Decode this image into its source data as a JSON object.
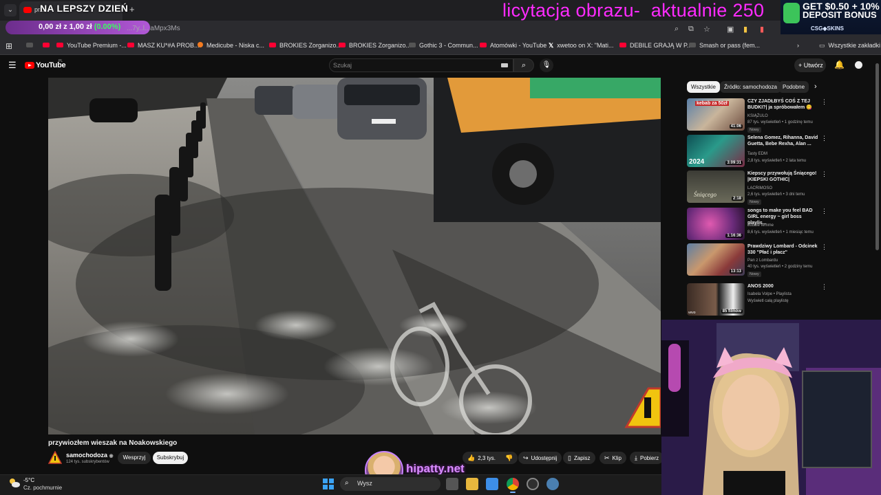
{
  "browser": {
    "tab_title": "pr... ",
    "tab_overlay_title": "NA LEPSZY DZIEŃ",
    "new_tab": "+",
    "url": "...7y..l...aMpx3Ms",
    "bookmarks": [
      {
        "label": "YouTube Premium -...",
        "icon": "youtube-icon"
      },
      {
        "label": "MASZ KU*#A PROB...",
        "icon": "youtube-icon"
      },
      {
        "label": "Medicube - Niska c...",
        "icon": "medicube-icon"
      },
      {
        "label": "BROKIES Zorganizo...",
        "icon": "youtube-icon"
      },
      {
        "label": "BROKIES Zorganizo...",
        "icon": "youtube-icon"
      },
      {
        "label": "Gothic 3 - Commun...",
        "icon": "globe-icon"
      },
      {
        "label": "Atomówki - YouTube",
        "icon": "youtube-icon"
      },
      {
        "label": "xwetoo on X: \"Mati...",
        "icon": "x-icon"
      },
      {
        "label": "DEBILE GRAJĄ W P...",
        "icon": "youtube-icon"
      },
      {
        "label": "Smash or pass (fem...",
        "icon": "globe-icon"
      }
    ],
    "all_bookmarks": "Wszystkie zakładki"
  },
  "stream_overlay": {
    "price_text": "0,00 zł z 1,00 zł",
    "price_pct": "(0.00%)",
    "auction_text": "licytacja obrazu-  aktualnie 250",
    "promo_line1": "GET $0.50 + 10%",
    "promo_line2": "DEPOSIT BONUS",
    "promo_brand": "CSG◆SKINS",
    "hipatty": "hipatty.net"
  },
  "youtube": {
    "logo_text": "YouTube",
    "country": "PL",
    "search_placeholder": "Szukaj",
    "create_label": "Utwórz",
    "video_title": "przywiozłem wieszak na Noakowskiego",
    "channel_name": "samochodoza",
    "channel_subs": "124 tys. subskrybentów",
    "support_label": "Wesprzyj",
    "subscribe_label": "Subskrybuj",
    "likes": "2,3 tys.",
    "share_label": "Udostępnij",
    "save_label": "Zapisz",
    "clip_label": "Klip",
    "download_label": "Pobierz",
    "chips": [
      "Wszystkie",
      "Źródło: samochodoza",
      "Podobne"
    ],
    "recommendations": [
      {
        "title": "CZY ZJADŁBYŚ COŚ Z TEJ BUDKI?| ja spróbowałem 😋",
        "channel": "KSIĄŻULO",
        "meta": "87 tys. wyświetleń • 1 godzinę temu",
        "duration": "41:06",
        "badge": "Nowy",
        "thumb_text": "kebab za 50zł"
      },
      {
        "title": "Selena Gomez, Rihanna, David Guetta, Bebe Rexha, Alan ...",
        "channel": "Tasty EDM",
        "meta": "2,8 tys. wyświetleń • 2 lata temu",
        "duration": "3:09:31",
        "badge": "",
        "thumb_text": "2024"
      },
      {
        "title": "Kiepscy przywołują Śniącego! |KIEPSKI GOTHIC|",
        "channel": "LACRIMOSO",
        "meta": "2,6 tys. wyświetleń • 3 dni temu",
        "duration": "2:18",
        "badge": "Nowy",
        "thumb_text": "Śniącego"
      },
      {
        "title": "songs to make you feel BAD GIRL energy ~ girl boss playlis...",
        "channel": "buddie femme",
        "meta": "8,6 tys. wyświetleń • 1 miesiąc temu",
        "duration": "1:16:36",
        "badge": "",
        "thumb_text": ""
      },
      {
        "title": "Prawdziwy Lombard - Odcinek 330 \"Płać i płacz\"",
        "channel": "Pan z Lombardu",
        "meta": "40 tys. wyświetleń • 2 godziny temu",
        "duration": "13:13",
        "badge": "Nowy",
        "thumb_text": ""
      },
      {
        "title": "ANOS 2000",
        "channel": "Isabela Volpe • Playlista",
        "meta": "Wyświetl całą playlistę",
        "duration": "85 filmów",
        "badge": "",
        "thumb_text": "vevo"
      }
    ]
  },
  "taskbar": {
    "temp": "-5°C",
    "weather": "Cz. pochmurnie",
    "search": "Wysz"
  },
  "colors": {
    "yt_red": "#ff0000",
    "overlay_pink": "#ff2bff",
    "price_green": "#39ff5e",
    "hipatty_purple": "#d98cff"
  }
}
